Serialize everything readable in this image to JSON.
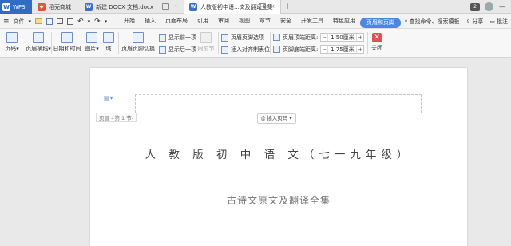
{
  "titlebar": {
    "app_tab": "WPS",
    "tabs": [
      {
        "label": "稻壳商城"
      },
      {
        "label": "新建 DOCX 文档.docx"
      },
      {
        "label": "人教版初中语...文及翻译全集"
      }
    ],
    "new_tab": "+",
    "badge": "2",
    "window_min": "—"
  },
  "menubar": {
    "file": "文件",
    "items": [
      "开始",
      "插入",
      "页面布局",
      "引用",
      "审阅",
      "视图",
      "章节",
      "安全",
      "开发工具",
      "特色应用",
      "页眉和页脚"
    ],
    "active_index": 10,
    "search": "查找命令、搜索模板",
    "share": "分享",
    "annotate": "批注"
  },
  "ribbon": {
    "page_number": "页码",
    "header_line": "页眉横线",
    "datetime": "日期和时间",
    "picture": "图片",
    "field": "域",
    "header_footer_switch": "页眉页脚切换",
    "show_prev": "显示前一项",
    "show_next": "显示后一项",
    "same_as_prev": "同前节",
    "header_footer_options": "页眉页脚选项",
    "insert_align_tab": "插入对齐制表位",
    "header_top_label": "页眉顶端距离:",
    "header_top_value": "1.50厘米",
    "footer_bottom_label": "页脚底端距离:",
    "footer_bottom_value": "1.75厘米",
    "close": "关闭"
  },
  "document": {
    "header_label": "页眉 - 第 1 节-",
    "insert_page_number": "插入页码",
    "title": "人 教 版 初 中 语 文（七一九年级）",
    "subtitle": "古诗文原文及翻译全集"
  }
}
